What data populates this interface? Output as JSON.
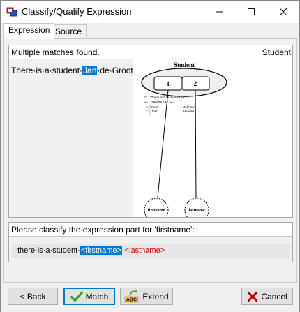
{
  "window": {
    "title": "Classify/Qualify Expression"
  },
  "tabs": [
    {
      "label": "Expression",
      "active": true
    },
    {
      "label": "Source",
      "active": false
    }
  ],
  "matches": {
    "status": "Multiple matches found.",
    "object_type": "Student",
    "expression_before": "There·is·a·student·",
    "expression_selected": "Jan",
    "expression_after": "·de·Groot"
  },
  "diagram": {
    "title": "Student",
    "role_1": "1",
    "role_2": "2",
    "fact_line_1": "F1 : \"There is a student <1> <2>.\"",
    "fact_line_2": "G1 : \"student <1> <2>\"",
    "population": [
      {
        "index": "1:",
        "first": "Peter",
        "last": "Johnson"
      },
      {
        "index": "2:",
        "first": "John",
        "last": "Hendrix"
      }
    ],
    "left_entity": "firstname",
    "right_entity": "lastname"
  },
  "classify": {
    "prompt": "Please classify the expression part for 'firstname':",
    "text_before": "there·is·a·student·",
    "tag_selected": "<firstname>",
    "separator": "·",
    "tag_other": "<lastname>"
  },
  "buttons": {
    "back": "< Back",
    "match": "Match",
    "extend": "Extend",
    "cancel": "Cancel"
  },
  "colors": {
    "selection": "#0078d7",
    "tag_red": "#d00000",
    "check_green": "#2e9c2e",
    "cancel_red": "#c00000"
  }
}
